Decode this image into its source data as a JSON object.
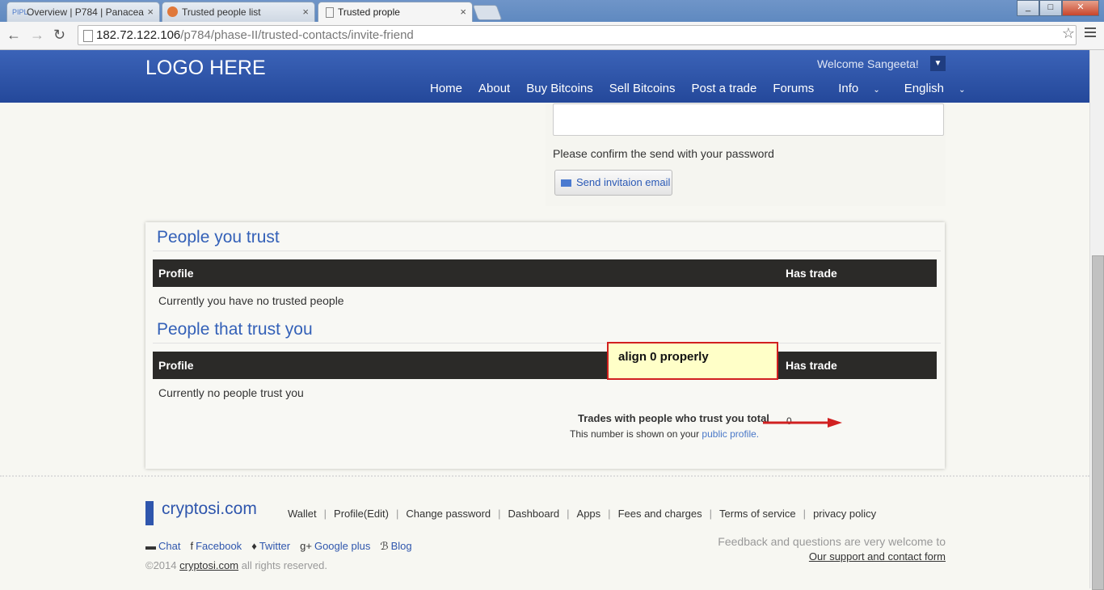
{
  "browser": {
    "tabs": [
      {
        "label": "Overview | P784 | Panacea",
        "icon": "PIPL"
      },
      {
        "label": "Trusted people list",
        "icon": ""
      },
      {
        "label": "Trusted prople",
        "icon": ""
      }
    ],
    "url_host": "182.72.122.106",
    "url_path": "/p784/phase-II/trusted-contacts/invite-friend"
  },
  "header": {
    "logo": "LOGO HERE",
    "welcome": "Welcome Sangeeta!",
    "nav": [
      "Home",
      "About",
      "Buy Bitcoins",
      "Sell Bitcoins",
      "Post a trade",
      "Forums",
      "Info",
      "English"
    ]
  },
  "invite_form": {
    "confirm_text": "Please confirm the send with your password",
    "send_label": "Send invitaion email"
  },
  "trust_panel": {
    "section1_title": "People you trust",
    "section1_cols": [
      "Profile",
      "Has trade"
    ],
    "section1_empty": "Currently you have no trusted people",
    "section2_title": "People that trust you",
    "section2_cols": [
      "Profile",
      "Has trade"
    ],
    "section2_empty": "Currently no people trust you",
    "totals_label": "Trades with people who trust you total",
    "totals_value": "0",
    "note_prefix": "This number is shown on your",
    "note_link": "public profile."
  },
  "annotation": {
    "text": "align 0 properly"
  },
  "footer": {
    "brand": "cryptosi.com",
    "links": [
      "Wallet",
      "Profile(Edit)",
      "Change password",
      "Dashboard",
      "Apps",
      "Fees and charges",
      "Terms of service",
      "privacy policy"
    ],
    "social": [
      "Chat",
      "Facebook",
      "Twitter",
      "Google plus",
      "Blog"
    ],
    "copyright_prefix": "©2014",
    "copyright_link": "cryptosi.com",
    "copyright_suffix": "all rights reserved.",
    "feedback": "Feedback and questions are very welcome to",
    "support_link": "Our support and contact form"
  },
  "colors": {
    "header": "#2f56ad",
    "accent": "#3461b8",
    "annotation_border": "#d12020"
  }
}
